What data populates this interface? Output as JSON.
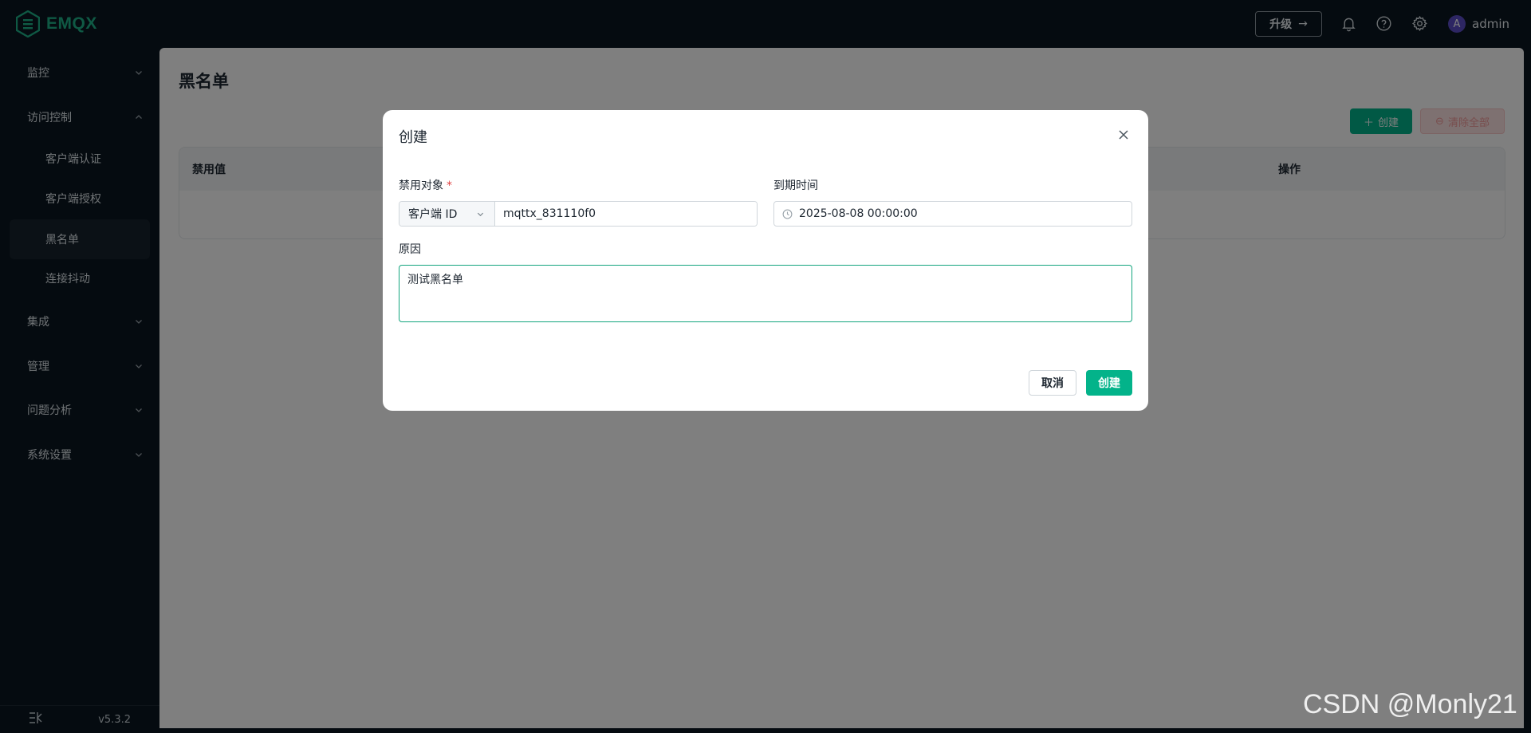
{
  "app": {
    "logo_text": "EMQX",
    "brand_color": "#03b38a"
  },
  "header": {
    "upgrade_label": "升级",
    "upgrade_arrow": "→",
    "user": {
      "avatar_letter": "A",
      "name": "admin"
    }
  },
  "sidebar": {
    "groups": [
      {
        "label": "监控",
        "expanded": false
      },
      {
        "label": "访问控制",
        "expanded": true
      },
      {
        "label": "集成",
        "expanded": false
      },
      {
        "label": "管理",
        "expanded": false
      },
      {
        "label": "问题分析",
        "expanded": false
      },
      {
        "label": "系统设置",
        "expanded": false
      }
    ],
    "access_control_items": [
      {
        "label": "客户端认证",
        "active": false
      },
      {
        "label": "客户端授权",
        "active": false
      },
      {
        "label": "黑名单",
        "active": true
      },
      {
        "label": "连接抖动",
        "active": false
      }
    ],
    "version": "v5.3.2"
  },
  "main": {
    "title": "黑名单",
    "create_label": "创建",
    "clear_all_label": "清除全部",
    "table": {
      "columns": [
        "禁用值",
        "操作"
      ]
    }
  },
  "dialog": {
    "title": "创建",
    "target_label": "禁用对象",
    "required_mark": "*",
    "target_type": "客户端 ID",
    "target_value": "mqttx_831110f0",
    "expire_label": "到期时间",
    "expire_value": "2025-08-08 00:00:00",
    "reason_label": "原因",
    "reason_value": "测试黑名单",
    "cancel_label": "取消",
    "submit_label": "创建"
  },
  "watermark": "CSDN @Monly21"
}
